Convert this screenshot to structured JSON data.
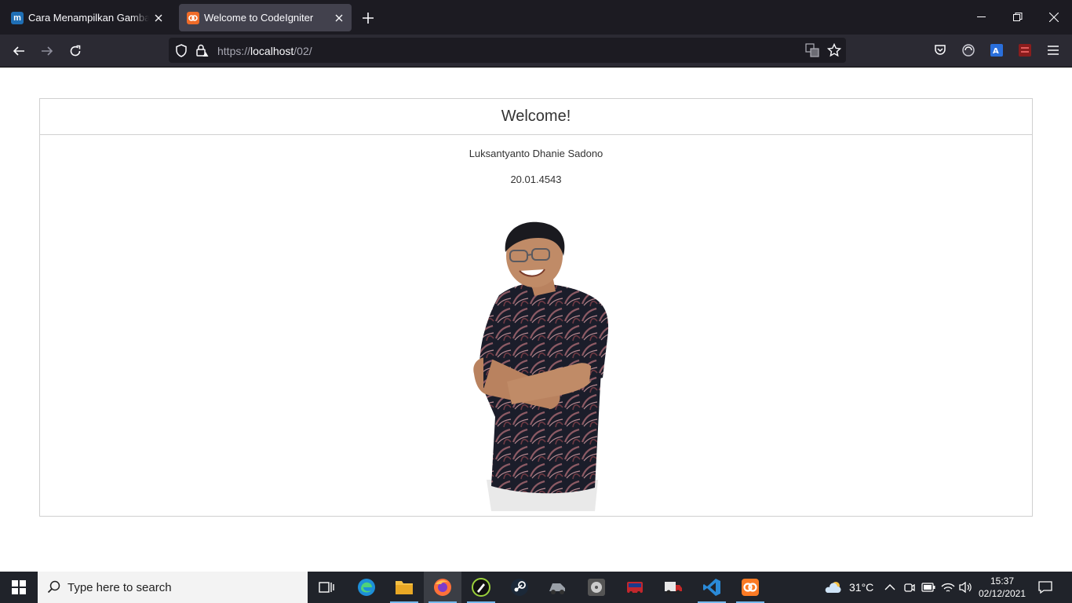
{
  "browser": {
    "tabs": [
      {
        "title": "Cara Menampilkan Gambar di H",
        "favicon": "m"
      },
      {
        "title": "Welcome to CodeIgniter",
        "favicon": "ci"
      }
    ],
    "url_scheme": "https://",
    "url_host": "localhost",
    "url_path": "/02/"
  },
  "page": {
    "header": "Welcome!",
    "name": "Luksantyanto Dhanie Sadono",
    "nim": "20.01.4543"
  },
  "taskbar": {
    "search_placeholder": "Type here to search",
    "weather": "31°C",
    "time": "15:37",
    "date": "02/12/2021"
  }
}
